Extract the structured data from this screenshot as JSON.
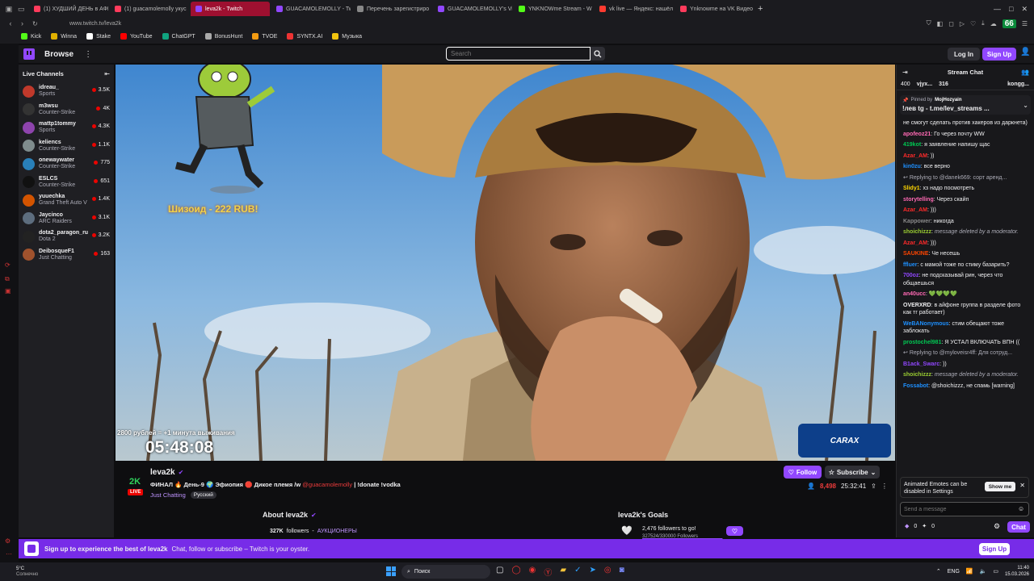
{
  "browser": {
    "tabs": [
      {
        "label": "(1) ХУДШИЙ ДЕНЬ в АФР",
        "color": "#ff3b5c"
      },
      {
        "label": "(1) guacamolemolly укус",
        "color": "#ff3b5c"
      },
      {
        "label": "leva2k - Twitch",
        "color": "#9147ff",
        "active": true
      },
      {
        "label": "GUACAMOLEMOLLY - Tw",
        "color": "#9147ff"
      },
      {
        "label": "Перечень зарегистриро",
        "color": "#888"
      },
      {
        "label": "GUACAMOLEMOLLY's Vi",
        "color": "#9147ff"
      },
      {
        "label": "YNKNOWme Stream - W",
        "color": "#53fc18"
      },
      {
        "label": "vk live — Яндекс: нашёл",
        "color": "#ff3b30"
      },
      {
        "label": "Ynknowme на VK Видео",
        "color": "#ff3b5c"
      }
    ],
    "url": "www.twitch.tv/leva2k",
    "bookmarks": [
      "Kick",
      "Winna",
      "Stake",
      "YouTube",
      "ChatGPT",
      "BonusHunt",
      "TVOE",
      "SYNTX.AI",
      "Музыка"
    ],
    "ext_badge": "66"
  },
  "nav": {
    "browse": "Browse",
    "search_placeholder": "Search",
    "login": "Log In",
    "signup": "Sign Up"
  },
  "sidebar": {
    "title": "Live Channels",
    "channels": [
      {
        "name": "idreau_",
        "game": "Sports",
        "viewers": "3.5K",
        "color": "#c0392b"
      },
      {
        "name": "m3wsu",
        "game": "Counter-Strike",
        "viewers": "4K",
        "color": "#333"
      },
      {
        "name": "mattp1tommy",
        "game": "Sports",
        "viewers": "4.3K",
        "color": "#8e44ad"
      },
      {
        "name": "keliencs",
        "game": "Counter-Strike",
        "viewers": "1.1K",
        "color": "#7f8c8d"
      },
      {
        "name": "onewaywater",
        "game": "Counter-Strike",
        "viewers": "775",
        "color": "#2980b9"
      },
      {
        "name": "ESLCS",
        "game": "Counter-Strike",
        "viewers": "651",
        "color": "#111"
      },
      {
        "name": "yuuechka",
        "game": "Grand Theft Auto V",
        "viewers": "1.4K",
        "color": "#d35400"
      },
      {
        "name": "Jaycinco",
        "game": "ARC Raiders",
        "viewers": "3.1K",
        "color": "#5d6d7e"
      },
      {
        "name": "dota2_paragon_ru",
        "game": "Dota 2",
        "viewers": "3.2K",
        "color": "#222"
      },
      {
        "name": "DeibosqueF1",
        "game": "Just Chatting",
        "viewers": "163",
        "color": "#a0522d"
      }
    ]
  },
  "video": {
    "overlay_price": "Шизоид - 222 RUB!",
    "timer_caption": "2800 рублей = +1 минута выживания",
    "timer": "05:48:08",
    "sponsor_logo": "CARAX"
  },
  "stream": {
    "avatar_text": "2K",
    "live": "LIVE",
    "channel": "leva2k",
    "title_prefix": "ФИНАЛ",
    "title_mid1": "День-9",
    "title_mid2": "Эфиопия",
    "title_mid3": "Дикое племя /w",
    "title_mention": "@guacamolemolly",
    "title_suffix": "| !donate !vodka",
    "category": "Just Chatting",
    "tag": "Русский",
    "follow": "Follow",
    "subscribe": "Subscribe",
    "viewers": "8,498",
    "uptime": "25:32:41"
  },
  "about": {
    "title": "About leva2k",
    "followers": "327K",
    "followers_label": "followers",
    "team": "АУКЦИОНЕРЫ",
    "goals_title": "leva2k's Goals",
    "goal_text": "2,476 followers to go!",
    "goal_progress": "327524/330000 Followers",
    "goal_fraction": 0.9925
  },
  "chat": {
    "title": "Stream Chat",
    "leaderboard": [
      {
        "rank": "400",
        "name": "vjyx..."
      },
      {
        "rank": "316",
        "name": ""
      },
      {
        "rank": "",
        "name": "kongg..."
      }
    ],
    "pinned_by": "Pinned by",
    "pinned_user": "MojHozyain",
    "pinned_text": "!лев tg - t.me/lev_streams ...",
    "messages": [
      {
        "user": "",
        "text": "не смогут сделать против хакеров из даркнета)",
        "color": "#efeff1"
      },
      {
        "user": "apofeoz21",
        "text": "Го через почту WW",
        "color": "#ff69b4"
      },
      {
        "user": "419kot",
        "text": "я заявление напишу щас",
        "color": "#00c853"
      },
      {
        "user": "Azar_AM",
        "text": "))",
        "color": "#ff2a2a"
      },
      {
        "user": "kin0zu",
        "text": "все верно",
        "color": "#1e90ff"
      },
      {
        "user": "",
        "text": "Replying to @danek669: сорт аренд...",
        "color": "#adadb8",
        "reply": true
      },
      {
        "user": "Slidy1",
        "text": "хз надо посмотреть",
        "color": "#ffd700"
      },
      {
        "user": "storytelling",
        "text": "Через скайп",
        "color": "#ff69b4"
      },
      {
        "user": "Azar_AM",
        "text": ")))",
        "color": "#ff2a2a"
      },
      {
        "user": "Kappower",
        "text": "никогда",
        "color": "#8a8a8a"
      },
      {
        "user": "shoichizzz",
        "text": "message deleted by a moderator.",
        "color": "#9acd32",
        "deleted": true
      },
      {
        "user": "Azar_AM",
        "text": ")))",
        "color": "#ff2a2a"
      },
      {
        "user": "SAUKINE",
        "text": "Че несешь",
        "color": "#ff4500"
      },
      {
        "user": "ffluer",
        "text": "с мамой тоже по стиму базарить?",
        "color": "#1e90ff"
      },
      {
        "user": "700oz",
        "text": "не подсказывай рин, через что общаешься",
        "color": "#9147ff"
      },
      {
        "user": "an40ucc",
        "text": "💚💚💚💚",
        "color": "#ff69b4"
      },
      {
        "user": "OVERXRD",
        "text": "в айфоне группа в разделе фото как тг работает)",
        "color": "#efeff1"
      },
      {
        "user": "WeBANonymous",
        "text": "стим обещают тоже заблокать",
        "color": "#1e90ff"
      },
      {
        "user": "prostochel981",
        "text": "Я УСТАЛ ВКЛЮЧАТЬ ВПН ((",
        "color": "#00c853"
      },
      {
        "user": "",
        "text": "Replying to @myloveisr4ff: Для сотруд...",
        "color": "#adadb8",
        "reply": true
      },
      {
        "user": "B1ack_Swarc",
        "text": "))",
        "color": "#9147ff"
      },
      {
        "user": "shoichizzz",
        "text": "message deleted by a moderator.",
        "color": "#9acd32",
        "deleted": true
      },
      {
        "user": "Fossabot",
        "text": "@shoichizzz, не спамь [warning]",
        "color": "#1e90ff"
      }
    ],
    "notice": "Animated Emotes can be disabled in Settings",
    "show_me": "Show me",
    "input_placeholder": "Send a message",
    "points_a": "0",
    "points_b": "0",
    "chat_button": "Chat"
  },
  "banner": {
    "bold": "Sign up to experience the best of leva2k",
    "text": "Chat, follow or subscribe – Twitch is your oyster.",
    "button": "Sign Up"
  },
  "taskbar": {
    "weather_temp": "5°C",
    "weather_text": "Солнечно",
    "search": "Поиск",
    "lang": "ENG",
    "time": "11:40",
    "date": "15.03.2026"
  }
}
